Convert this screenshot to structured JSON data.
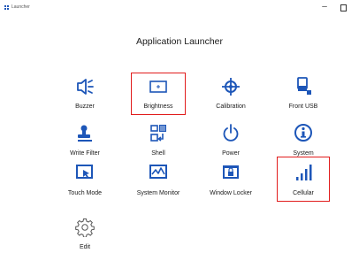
{
  "window": {
    "title": "Launcher",
    "minimize_label": "–"
  },
  "heading": "Application Launcher",
  "accent_color": "#1d56b8",
  "highlight_color": "#e11c1c",
  "tiles": [
    {
      "label": "Buzzer",
      "icon": "buzzer-icon"
    },
    {
      "label": "Brightness",
      "icon": "brightness-icon",
      "highlighted": true
    },
    {
      "label": "Calibration",
      "icon": "calibration-crosshair-icon"
    },
    {
      "label": "Front USB",
      "icon": "usb-device-icon"
    },
    {
      "label": "Write Filter",
      "icon": "write-filter-icon"
    },
    {
      "label": "Shell",
      "icon": "shell-icon"
    },
    {
      "label": "Power",
      "icon": "power-icon"
    },
    {
      "label": "System",
      "icon": "info-icon"
    },
    {
      "label": "Touch Mode",
      "icon": "touch-mode-icon"
    },
    {
      "label": "System Monitor",
      "icon": "system-monitor-icon"
    },
    {
      "label": "Window Locker",
      "icon": "window-locker-icon"
    },
    {
      "label": "Cellular",
      "icon": "cellular-signal-icon",
      "highlighted": true
    },
    {
      "label": "Edit",
      "icon": "gear-icon"
    }
  ]
}
